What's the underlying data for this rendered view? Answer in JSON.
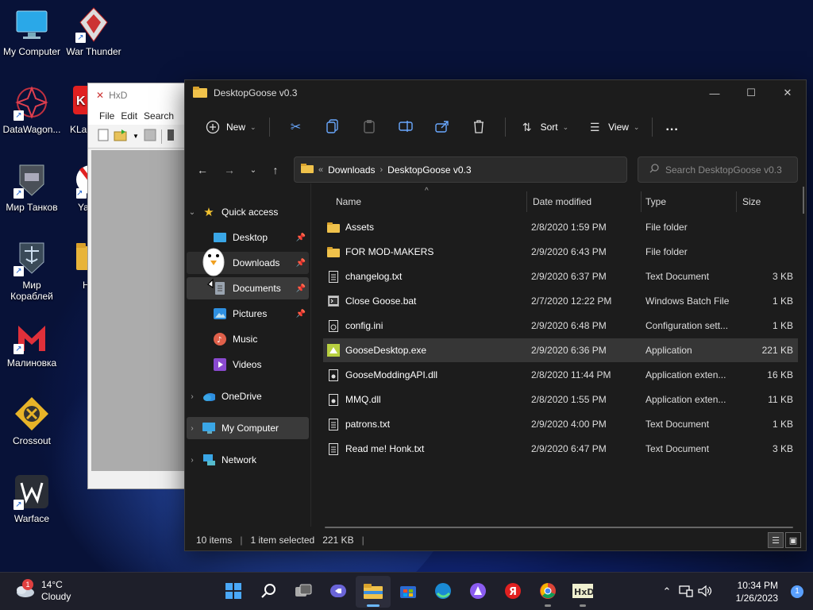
{
  "desktop": {
    "icons": [
      {
        "label": "My Computer"
      },
      {
        "label": "War Thunder"
      },
      {
        "label": "DataWagon..."
      },
      {
        "label": "KLau"
      },
      {
        "label": "Мир Танков"
      },
      {
        "label": "Ya"
      },
      {
        "label": "Мир Кораблей"
      },
      {
        "label": "H"
      },
      {
        "label": "Малиновка"
      },
      {
        "label": "Crossout"
      },
      {
        "label": "Warface"
      }
    ]
  },
  "hxd": {
    "title": "HxD",
    "menu": [
      "File",
      "Edit",
      "Search"
    ]
  },
  "explorer": {
    "title": "DesktopGoose v0.3",
    "commands": {
      "new": "New",
      "sort": "Sort",
      "view": "View",
      "more": "..."
    },
    "address": {
      "crumbs": [
        "Downloads",
        "DesktopGoose v0.3"
      ],
      "search_placeholder": "Search DesktopGoose v0.3"
    },
    "nav": {
      "quick_access": "Quick access",
      "items": [
        {
          "label": "Desktop"
        },
        {
          "label": "Downloads"
        },
        {
          "label": "Documents"
        },
        {
          "label": "Pictures"
        },
        {
          "label": "Music"
        },
        {
          "label": "Videos"
        }
      ],
      "onedrive": "OneDrive",
      "my_computer": "My Computer",
      "network": "Network"
    },
    "columns": {
      "name": "Name",
      "date": "Date modified",
      "type": "Type",
      "size": "Size"
    },
    "files": [
      {
        "name": "Assets",
        "date": "2/8/2020 1:59 PM",
        "type": "File folder",
        "size": "",
        "icon": "folder"
      },
      {
        "name": "FOR MOD-MAKERS",
        "date": "2/9/2020 6:43 PM",
        "type": "File folder",
        "size": "",
        "icon": "folder"
      },
      {
        "name": "changelog.txt",
        "date": "2/9/2020 6:37 PM",
        "type": "Text Document",
        "size": "3 KB",
        "icon": "text"
      },
      {
        "name": "Close Goose.bat",
        "date": "2/7/2020 12:22 PM",
        "type": "Windows Batch File",
        "size": "1 KB",
        "icon": "batch"
      },
      {
        "name": "config.ini",
        "date": "2/9/2020 6:48 PM",
        "type": "Configuration sett...",
        "size": "1 KB",
        "icon": "config"
      },
      {
        "name": "GooseDesktop.exe",
        "date": "2/9/2020 6:36 PM",
        "type": "Application",
        "size": "221 KB",
        "icon": "exe"
      },
      {
        "name": "GooseModdingAPI.dll",
        "date": "2/8/2020 11:44 PM",
        "type": "Application exten...",
        "size": "16 KB",
        "icon": "dll"
      },
      {
        "name": "MMQ.dll",
        "date": "2/8/2020 1:55 PM",
        "type": "Application exten...",
        "size": "11 KB",
        "icon": "dll"
      },
      {
        "name": "patrons.txt",
        "date": "2/9/2020 4:00 PM",
        "type": "Text Document",
        "size": "1 KB",
        "icon": "text"
      },
      {
        "name": "Read me! Honk.txt",
        "date": "2/9/2020 6:47 PM",
        "type": "Text Document",
        "size": "3 KB",
        "icon": "text"
      }
    ],
    "status": {
      "items": "10 items",
      "selected": "1 item selected",
      "size": "221 KB"
    }
  },
  "taskbar": {
    "weather": {
      "temp": "14°C",
      "condition": "Cloudy",
      "badge": "1"
    },
    "clock": {
      "time": "10:34 PM",
      "date": "1/26/2023"
    },
    "notif_count": "1"
  }
}
